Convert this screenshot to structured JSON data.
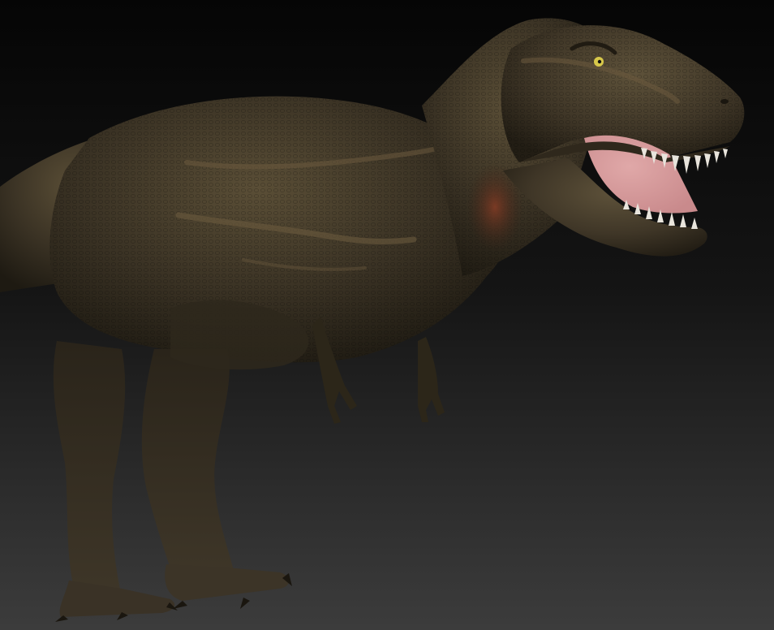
{
  "scene": {
    "subject": "tyrannosaurus-sculpt",
    "colors": {
      "background_top": "#050505",
      "background_bottom": "#3c3c3c",
      "skin_base": "#3a3224",
      "skin_dark": "#1e1a12",
      "skin_light": "#5a4e36",
      "stripe": "#6b5a3e",
      "throat_red": "#7a3a24",
      "mouth_pink": "#c98a8c",
      "tooth": "#e8e4dc",
      "eye": "#d8c84a"
    }
  }
}
